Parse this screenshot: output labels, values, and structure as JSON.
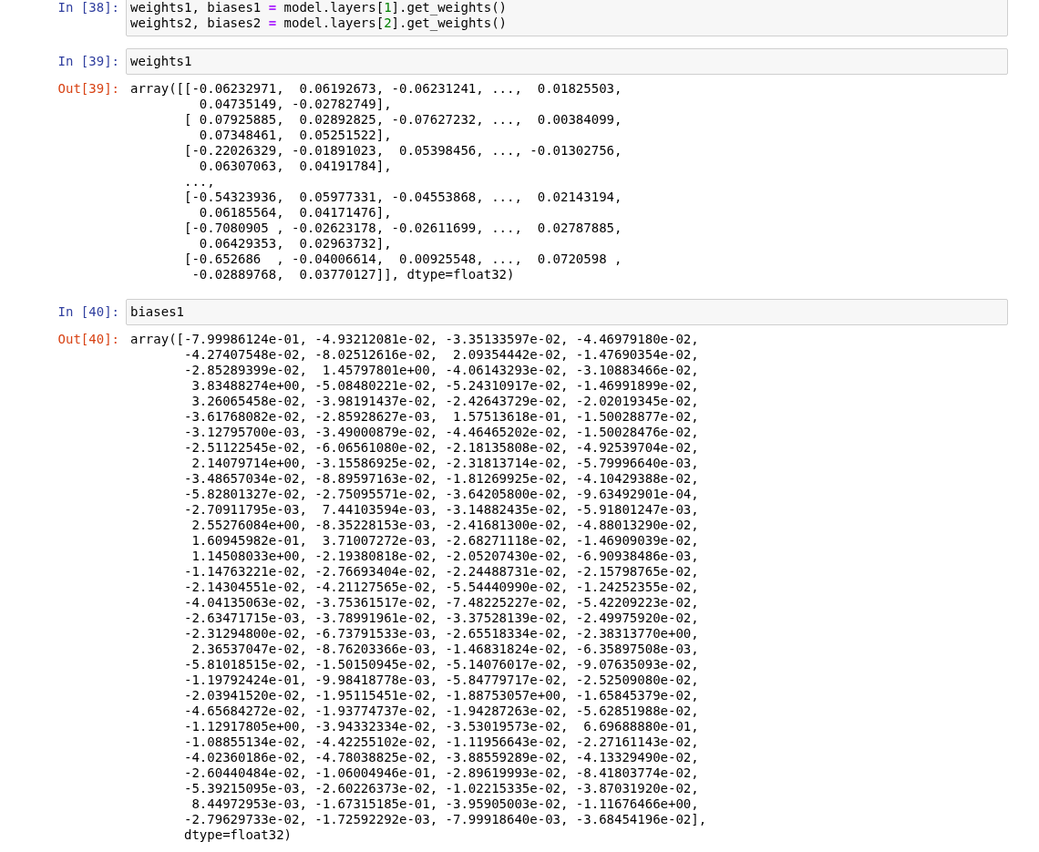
{
  "cells": [
    {
      "kind": "input",
      "prompt": "In [38]:",
      "lines": [
        [
          {
            "text": "weights1, biases1 ",
            "kind": "name"
          },
          {
            "text": "=",
            "kind": "operator"
          },
          {
            "text": " model.layers[",
            "kind": "name"
          },
          {
            "text": "1",
            "kind": "number"
          },
          {
            "text": "].get_weights()",
            "kind": "name"
          }
        ],
        [
          {
            "text": "weights2, biases2 ",
            "kind": "name"
          },
          {
            "text": "=",
            "kind": "operator"
          },
          {
            "text": " model.layers[",
            "kind": "name"
          },
          {
            "text": "2",
            "kind": "number"
          },
          {
            "text": "].get_weights()",
            "kind": "name"
          }
        ]
      ]
    },
    {
      "kind": "input",
      "prompt": "In [39]:",
      "lines": [
        [
          {
            "text": "weights1",
            "kind": "name"
          }
        ]
      ]
    },
    {
      "kind": "output",
      "prompt": "Out[39]:",
      "lines": [
        "array([[-0.06232971,  0.06192673, -0.06231241, ...,  0.01825503,",
        "         0.04735149, -0.02782749],",
        "       [ 0.07925885,  0.02892825, -0.07627232, ...,  0.00384099,",
        "         0.07348461,  0.05251522],",
        "       [-0.22026329, -0.01891023,  0.05398456, ..., -0.01302756,",
        "         0.06307063,  0.04191784],",
        "       ...,",
        "       [-0.54323936,  0.05977331, -0.04553868, ...,  0.02143194,",
        "         0.06185564,  0.04171476],",
        "       [-0.7080905 , -0.02623178, -0.02611699, ...,  0.02787885,",
        "         0.06429353,  0.02963732],",
        "       [-0.652686  , -0.04006614,  0.00925548, ...,  0.0720598 ,",
        "        -0.02889768,  0.03770127]], dtype=float32)"
      ]
    },
    {
      "kind": "input",
      "prompt": "In [40]:",
      "lines": [
        [
          {
            "text": "biases1",
            "kind": "name"
          }
        ]
      ]
    },
    {
      "kind": "output",
      "prompt": "Out[40]:",
      "lines": [
        "array([-7.99986124e-01, -4.93212081e-02, -3.35133597e-02, -4.46979180e-02,",
        "       -4.27407548e-02, -8.02512616e-02,  2.09354442e-02, -1.47690354e-02,",
        "       -2.85289399e-02,  1.45797801e+00, -4.06143293e-02, -3.10883466e-02,",
        "        3.83488274e+00, -5.08480221e-02, -5.24310917e-02, -1.46991899e-02,",
        "        3.26065458e-02, -3.98191437e-02, -2.42643729e-02, -2.02019345e-02,",
        "       -3.61768082e-02, -2.85928627e-03,  1.57513618e-01, -1.50028877e-02,",
        "       -3.12795700e-03, -3.49000879e-02, -4.46465202e-02, -1.50028476e-02,",
        "       -2.51122545e-02, -6.06561080e-02, -2.18135808e-02, -4.92539704e-02,",
        "        2.14079714e+00, -3.15586925e-02, -2.31813714e-02, -5.79996640e-03,",
        "       -3.48657034e-02, -8.89597163e-02, -1.81269925e-02, -4.10429388e-02,",
        "       -5.82801327e-02, -2.75095571e-02, -3.64205800e-02, -9.63492901e-04,",
        "       -2.70911795e-03,  7.44103594e-03, -3.14882435e-02, -5.91801247e-03,",
        "        2.55276084e+00, -8.35228153e-03, -2.41681300e-02, -4.88013290e-02,",
        "        1.60945982e-01,  3.71007272e-03, -2.68271118e-02, -1.46909039e-02,",
        "        1.14508033e+00, -2.19380818e-02, -2.05207430e-02, -6.90938486e-03,",
        "       -1.14763221e-02, -2.76693404e-02, -2.24488731e-02, -2.15798765e-02,",
        "       -2.14304551e-02, -4.21127565e-02, -5.54440990e-02, -1.24252355e-02,",
        "       -4.04135063e-02, -3.75361517e-02, -7.48225227e-02, -5.42209223e-02,",
        "       -2.63471715e-03, -3.78991961e-02, -3.37528139e-02, -2.49975920e-02,",
        "       -2.31294800e-02, -6.73791533e-03, -2.65518334e-02, -2.38313770e+00,",
        "        2.36537047e-02, -8.76203366e-03, -1.46831824e-02, -6.35897508e-03,",
        "       -5.81018515e-02, -1.50150945e-02, -5.14076017e-02, -9.07635093e-02,",
        "       -1.19792424e-01, -9.98418778e-03, -5.84779717e-02, -2.52509080e-02,",
        "       -2.03941520e-02, -1.95115451e-02, -1.88753057e+00, -1.65845379e-02,",
        "       -4.65684272e-02, -1.93774737e-02, -1.94287263e-02, -5.62851988e-02,",
        "       -1.12917805e+00, -3.94332334e-02, -3.53019573e-02,  6.69688880e-01,",
        "       -1.08855134e-02, -4.42255102e-02, -1.11956643e-02, -2.27161143e-02,",
        "       -4.02360186e-02, -4.78038825e-02, -3.88559289e-02, -4.13329490e-02,",
        "       -2.60440484e-02, -1.06004946e-01, -2.89619993e-02, -8.41803774e-02,",
        "       -5.39215095e-03, -2.60226373e-02, -1.02215335e-02, -3.87031920e-02,",
        "        8.44972953e-03, -1.67315185e-01, -3.95905003e-02, -1.11676466e+00,",
        "       -2.79629733e-02, -1.72592292e-03, -7.99918640e-03, -3.68454196e-02],",
        "       dtype=float32)"
      ]
    }
  ]
}
